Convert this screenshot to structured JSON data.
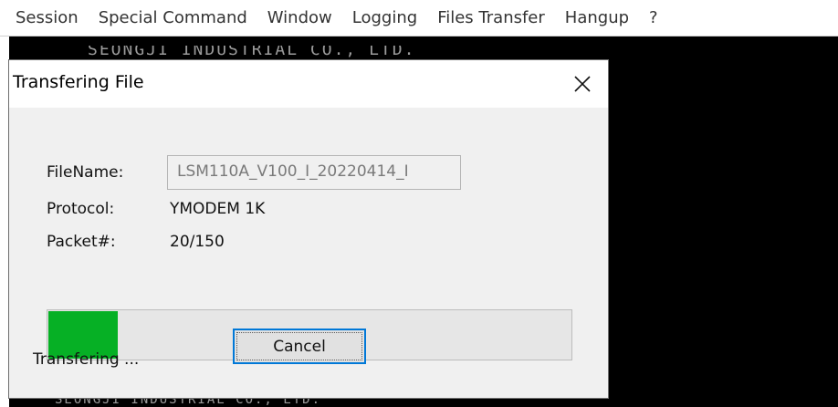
{
  "menubar": {
    "items": [
      "Session",
      "Special Command",
      "Window",
      "Logging",
      "Files Transfer",
      "Hangup",
      "?"
    ]
  },
  "terminal": {
    "partial_line": "SEONGJI INDUSTRIAL CO., LTD."
  },
  "dialog": {
    "title": "Transfering File",
    "close_icon": "close-icon",
    "filename_label": "FileName:",
    "filename_value": "LSM110A_V100_I_20220414_I",
    "protocol_label": "Protocol:",
    "protocol_value": "YMODEM 1K",
    "packet_label": "Packet#:",
    "packet_value": "20/150",
    "progress_fraction": 0.133,
    "progress_color": "#06b025",
    "status_text": "Transfering ...",
    "cancel_label": "Cancel"
  }
}
